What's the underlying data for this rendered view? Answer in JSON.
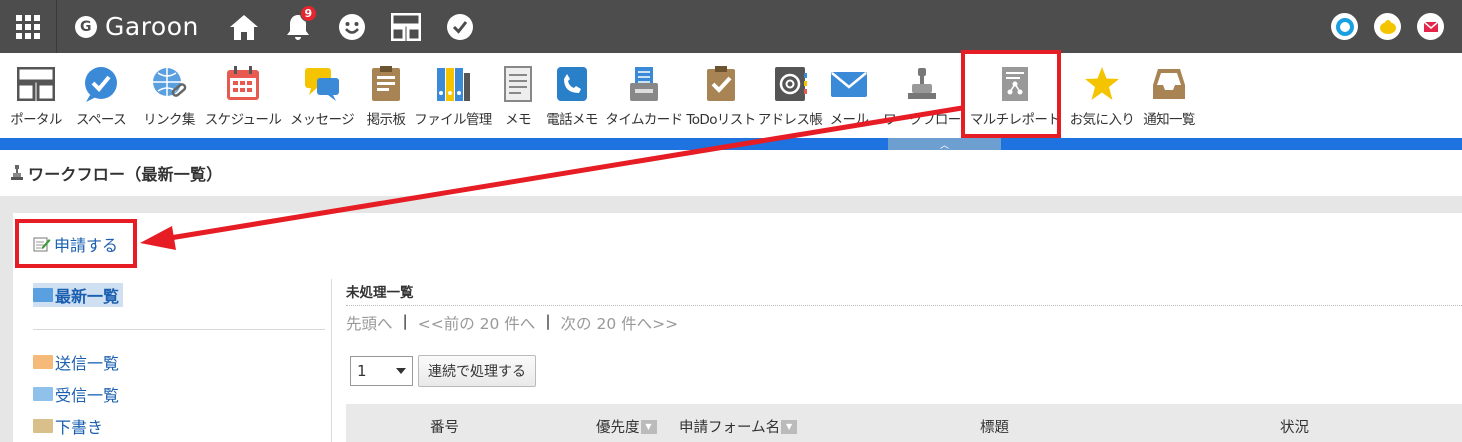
{
  "header": {
    "brand": "Garoon",
    "brand_letter": "G",
    "notification_count": "9",
    "icons": [
      "home-icon",
      "bell-icon",
      "smile-icon",
      "layout-icon",
      "check-bubble-icon"
    ]
  },
  "apps": [
    {
      "label": "ポータル",
      "icon": "portal-icon"
    },
    {
      "label": "スペース",
      "icon": "space-icon"
    },
    {
      "label": "リンク集",
      "icon": "globe-link-icon"
    },
    {
      "label": "スケジュール",
      "icon": "calendar-icon"
    },
    {
      "label": "メッセージ",
      "icon": "message-icon"
    },
    {
      "label": "掲示板",
      "icon": "bulletin-icon"
    },
    {
      "label": "ファイル管理",
      "icon": "binder-icon"
    },
    {
      "label": "メモ",
      "icon": "memo-icon"
    },
    {
      "label": "電話メモ",
      "icon": "phone-icon"
    },
    {
      "label": "タイムカード",
      "icon": "timecard-icon"
    },
    {
      "label": "ToDoリスト",
      "icon": "todo-icon"
    },
    {
      "label": "アドレス帳",
      "icon": "address-icon"
    },
    {
      "label": "メール",
      "icon": "mail-icon"
    },
    {
      "label": "ワークフロー",
      "icon": "stamp-icon"
    },
    {
      "label": "マルチレポート",
      "icon": "report-icon"
    },
    {
      "label": "お気に入り",
      "icon": "star-icon"
    },
    {
      "label": "通知一覧",
      "icon": "inbox-icon"
    }
  ],
  "page": {
    "title": "ワークフロー（最新一覧）",
    "apply_label": "申請する"
  },
  "sidebar": {
    "selected": "最新一覧",
    "folders": [
      {
        "label": "送信一覧",
        "color": "#f5b97a"
      },
      {
        "label": "受信一覧",
        "color": "#8fc1ea"
      },
      {
        "label": "下書き",
        "color": "#d9c08a"
      }
    ]
  },
  "main": {
    "heading": "未処理一覧",
    "pager": {
      "first": "先頭へ",
      "sep": "|",
      "prev": "<<前の 20 件へ",
      "next": "次の 20 件へ>>"
    },
    "select_value": "1",
    "bulk_button": "連続で処理する",
    "columns": [
      "番号",
      "優先度",
      "申請フォーム名",
      "標題",
      "状況"
    ]
  },
  "colors": {
    "accent": "#1e73e0",
    "annotation": "#e61d24",
    "link": "#1a5fb0"
  }
}
